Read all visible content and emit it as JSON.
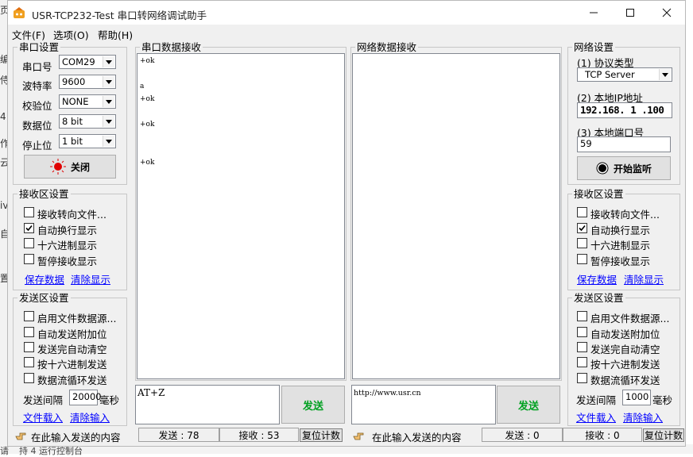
{
  "window": {
    "title": "USR-TCP232-Test 串口转网络调试助手",
    "minimize": "—",
    "maximize": "☐",
    "close": "✕"
  },
  "menu": [
    "文件(F)",
    "选项(O)",
    "帮助(H)"
  ],
  "serial_settings": {
    "legend": "串口设置",
    "port_label": "串口号",
    "port_value": "COM29",
    "baud_label": "波特率",
    "baud_value": "9600",
    "parity_label": "校验位",
    "parity_value": "NONE",
    "data_label": "数据位",
    "data_value": "8 bit",
    "stop_label": "停止位",
    "stop_value": "1 bit",
    "close_button": "关闭"
  },
  "left_receive_settings": {
    "legend": "接收区设置",
    "options": [
      {
        "label": "接收转向文件...",
        "checked": false
      },
      {
        "label": "自动换行显示",
        "checked": true
      },
      {
        "label": "十六进制显示",
        "checked": false
      },
      {
        "label": "暂停接收显示",
        "checked": false
      }
    ],
    "save_link": "保存数据",
    "clear_link": "清除显示"
  },
  "left_send_settings": {
    "legend": "发送区设置",
    "options": [
      {
        "label": "启用文件数据源...",
        "checked": false
      },
      {
        "label": "自动发送附加位",
        "checked": false
      },
      {
        "label": "发送完自动清空",
        "checked": false
      },
      {
        "label": "按十六进制发送",
        "checked": false
      },
      {
        "label": "数据流循环发送",
        "checked": false
      }
    ],
    "interval_label": "发送间隔",
    "interval_value": "20000",
    "interval_unit": "毫秒",
    "load_link": "文件载入",
    "clear_link": "清除输入"
  },
  "serial_receive": {
    "legend": "串口数据接收",
    "lines": [
      "+ok",
      "",
      "",
      "a",
      "+ok",
      "",
      "",
      "+ok",
      "",
      "",
      "",
      "",
      "+ok"
    ]
  },
  "network_receive": {
    "legend": "网络数据接收"
  },
  "serial_send": {
    "text": "AT+Z",
    "send_button": "发送"
  },
  "network_send": {
    "text": "http://www.usr.cn",
    "send_button": "发送"
  },
  "network_settings": {
    "legend": "网络设置",
    "protocol_label": "(1) 协议类型",
    "protocol_value": "TCP Server",
    "ip_label": "(2) 本地IP地址",
    "ip_value": "192.168. 1 .100",
    "port_label": "(3) 本地端口号",
    "port_value": "59",
    "listen_button": "开始监听"
  },
  "right_receive_settings": {
    "legend": "接收区设置",
    "options": [
      {
        "label": "接收转向文件...",
        "checked": false
      },
      {
        "label": "自动换行显示",
        "checked": true
      },
      {
        "label": "十六进制显示",
        "checked": false
      },
      {
        "label": "暂停接收显示",
        "checked": false
      }
    ],
    "save_link": "保存数据",
    "clear_link": "清除显示"
  },
  "right_send_settings": {
    "legend": "发送区设置",
    "options": [
      {
        "label": "启用文件数据源...",
        "checked": false
      },
      {
        "label": "自动发送附加位",
        "checked": false
      },
      {
        "label": "发送完自动清空",
        "checked": false
      },
      {
        "label": "按十六进制发送",
        "checked": false
      },
      {
        "label": "数据流循环发送",
        "checked": false
      }
    ],
    "interval_label": "发送间隔",
    "interval_value": "1000",
    "interval_unit": "毫秒",
    "load_link": "文件载入",
    "clear_link": "清除输入"
  },
  "status": {
    "left_msg": "在此输入发送的内容",
    "left_send": "发送 : 78",
    "left_recv": "接收 : 53",
    "left_reset": "复位计数",
    "right_msg": "在此输入发送的内容",
    "right_send": "发送 : 0",
    "right_recv": "接收 : 0",
    "right_reset": "复位计数"
  },
  "background_app": {
    "side_chars": [
      "页",
      "编",
      "侍",
      "4",
      "作",
      "云",
      "iv",
      "自",
      "置"
    ],
    "bottom_text_a": "请",
    "bottom_text_b": "持 4 运行控制台"
  },
  "colors": {
    "link": "#0000ff",
    "send_green": "#00a020",
    "indicator_red": "#e00000"
  }
}
